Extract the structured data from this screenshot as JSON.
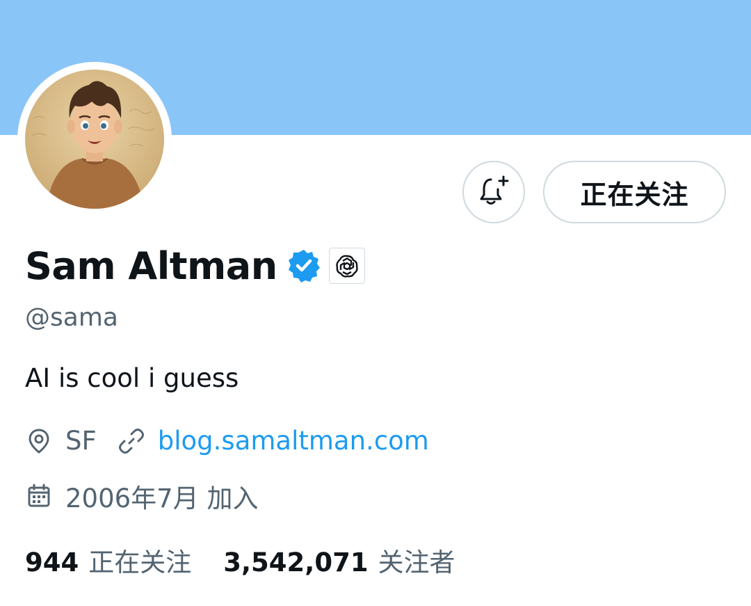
{
  "header": {
    "banner_color": "#8ac5f8"
  },
  "profile": {
    "display_name": "Sam Altman",
    "handle": "@sama",
    "bio": "AI is cool i guess",
    "verified_icon": "verified-badge-icon",
    "affiliate_icon": "openai-logo-icon",
    "location": "SF",
    "website": "blog.samaltman.com",
    "joined": "2006年7月 加入"
  },
  "actions": {
    "notify_icon": "bell-plus-icon",
    "following_label": "正在关注"
  },
  "stats": {
    "following_count": "944",
    "following_label": "正在关注",
    "followers_count": "3,542,071",
    "followers_label": "关注者"
  },
  "colors": {
    "accent": "#1d9bf0",
    "secondary_text": "#536471",
    "primary_text": "#0f1419",
    "border": "#cfd9de"
  }
}
